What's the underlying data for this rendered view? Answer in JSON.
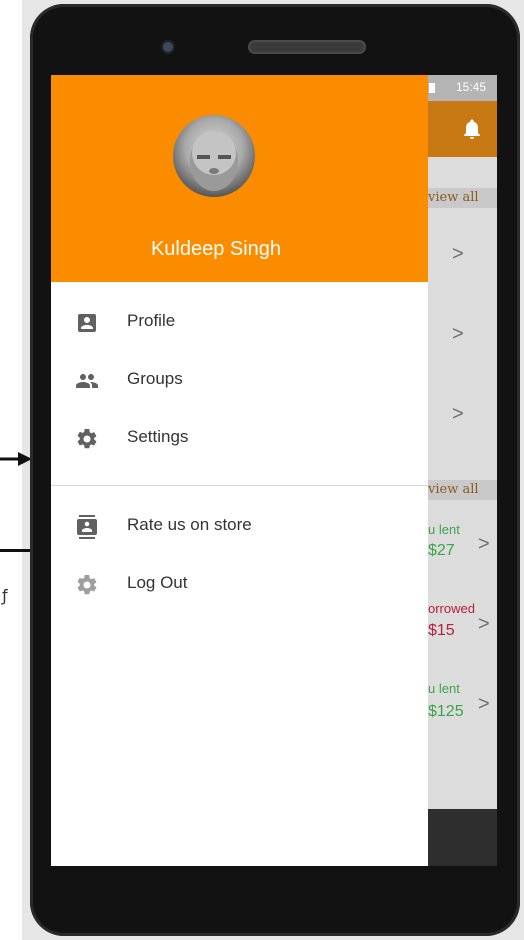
{
  "status_bar": {
    "time": "15:45"
  },
  "background_app": {
    "view_all_label": "view all",
    "entries": [
      {
        "label": "u lent",
        "amount": "$27",
        "color": "#3aa54a"
      },
      {
        "label": "orrowed",
        "amount": "$15",
        "color": "#b5203e"
      },
      {
        "label": "u lent",
        "amount": "$125",
        "color": "#3aa54a"
      }
    ]
  },
  "drawer": {
    "user_name": "Kuldeep Singh",
    "header_color": "#fb8c00",
    "menu_group_1": [
      {
        "label": "Profile",
        "icon": "account-box-icon"
      },
      {
        "label": "Groups",
        "icon": "group-icon"
      },
      {
        "label": "Settings",
        "icon": "settings-icon"
      }
    ],
    "menu_group_2": [
      {
        "label": "Rate us on store",
        "icon": "contact-card-icon"
      },
      {
        "label": "Log Out",
        "icon": "settings-icon"
      }
    ]
  }
}
